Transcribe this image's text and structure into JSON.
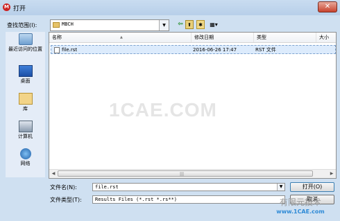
{
  "window": {
    "title": "打开",
    "close_glyph": "✕"
  },
  "lookin": {
    "label": "查找范围(I):",
    "value": "MBCH"
  },
  "toolbar": {
    "back": "⇦",
    "up": "⬆",
    "newfolder": "✱",
    "view": "▦▾"
  },
  "places": [
    {
      "label": "最近访问的位置",
      "icon": "recent-places-icon"
    },
    {
      "label": "桌面",
      "icon": "desktop-icon"
    },
    {
      "label": "库",
      "icon": "library-icon"
    },
    {
      "label": "计算机",
      "icon": "computer-icon"
    },
    {
      "label": "网络",
      "icon": "network-icon"
    }
  ],
  "columns": {
    "name": "名称",
    "date": "修改日期",
    "type": "类型",
    "size": "大小"
  },
  "files": [
    {
      "name": "file.rst",
      "date": "2016-06-26 17:47",
      "type": "RST 文件"
    }
  ],
  "filename": {
    "label": "文件名(N):",
    "value": "file.rst"
  },
  "filetype": {
    "label": "文件类型(T):",
    "value": "Results Files (*.rst *.rs**)"
  },
  "buttons": {
    "open": "打开(O)",
    "cancel": "取消"
  },
  "watermarks": {
    "center": "1CAE.COM",
    "brand": "有限元技术",
    "url": "www.1CAE.com"
  }
}
